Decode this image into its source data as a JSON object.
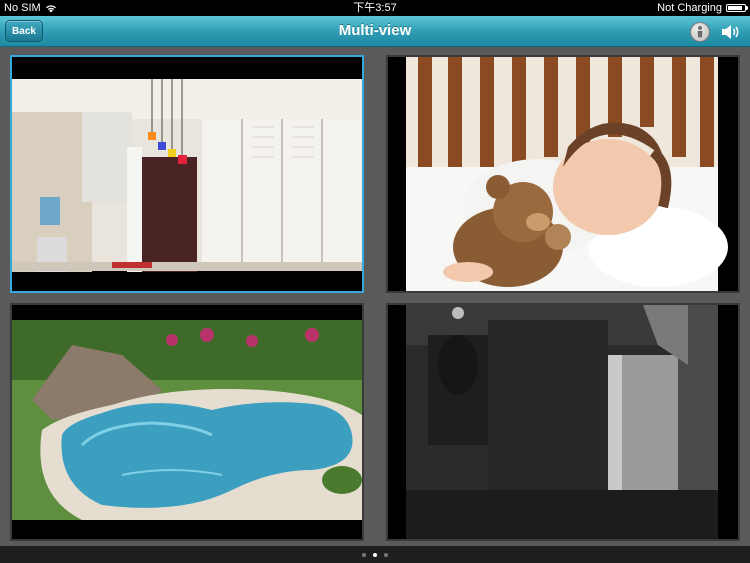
{
  "status_bar": {
    "carrier": "No SIM",
    "time": "下午3:57",
    "charging": "Not Charging"
  },
  "nav": {
    "back_label": "Back",
    "title": "Multi-view",
    "info_icon": "person-info-icon",
    "speaker_icon": "speaker-icon"
  },
  "cameras": [
    {
      "id": "camera-1",
      "scene": "kitchen",
      "selected": true
    },
    {
      "id": "camera-2",
      "scene": "sleeping child with teddy bear",
      "selected": false
    },
    {
      "id": "camera-3",
      "scene": "backyard pool",
      "selected": false
    },
    {
      "id": "camera-4",
      "scene": "night vision room",
      "selected": false
    }
  ],
  "pager": {
    "pages": 3,
    "current": 2
  },
  "colors": {
    "nav_bar": "#2e9bb2",
    "selected_border": "#35a8dd",
    "background": "#5a5a5a"
  }
}
